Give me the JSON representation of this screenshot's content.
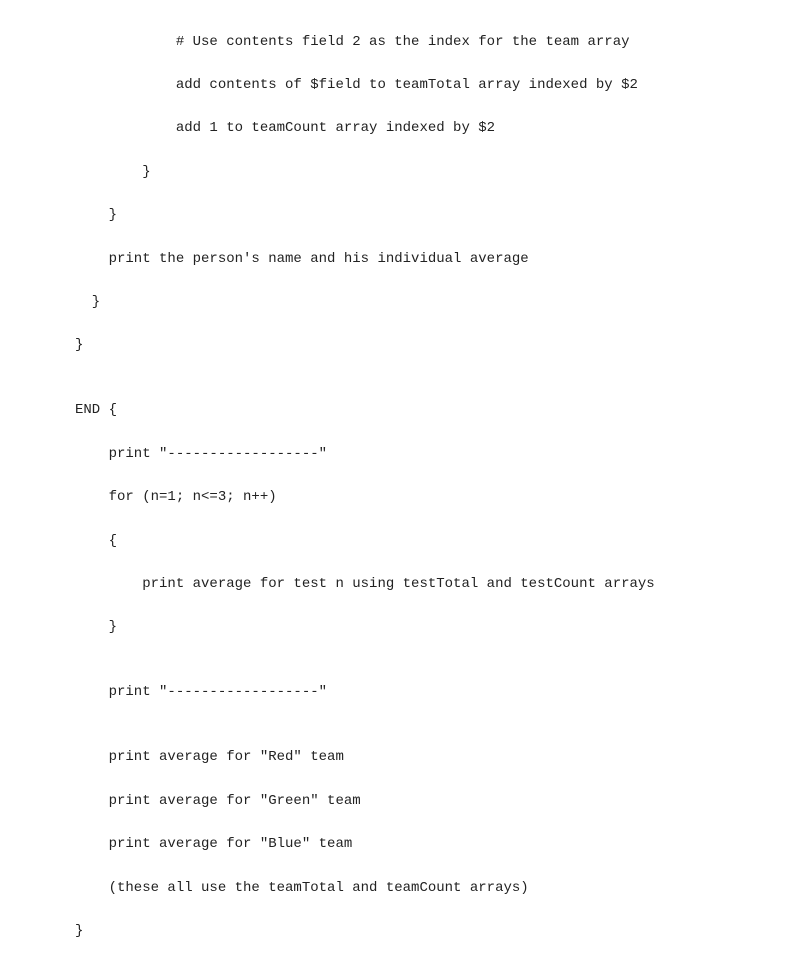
{
  "code": {
    "lines": [
      "            # Use contents field 2 as the index for the team array",
      "            add contents of $field to teamTotal array indexed by $2",
      "            add 1 to teamCount array indexed by $2",
      "        }",
      "    }",
      "    print the person's name and his individual average",
      "  }",
      "}",
      "",
      "END {",
      "    print \"------------------\"",
      "    for (n=1; n<=3; n++)",
      "    {",
      "        print average for test n using testTotal and testCount arrays",
      "    }",
      "",
      "    print \"------------------\"",
      "",
      "    print average for \"Red\" team",
      "    print average for \"Green\" team",
      "    print average for \"Blue\" team",
      "    (these all use the teamTotal and teamCount arrays)",
      "}"
    ]
  }
}
